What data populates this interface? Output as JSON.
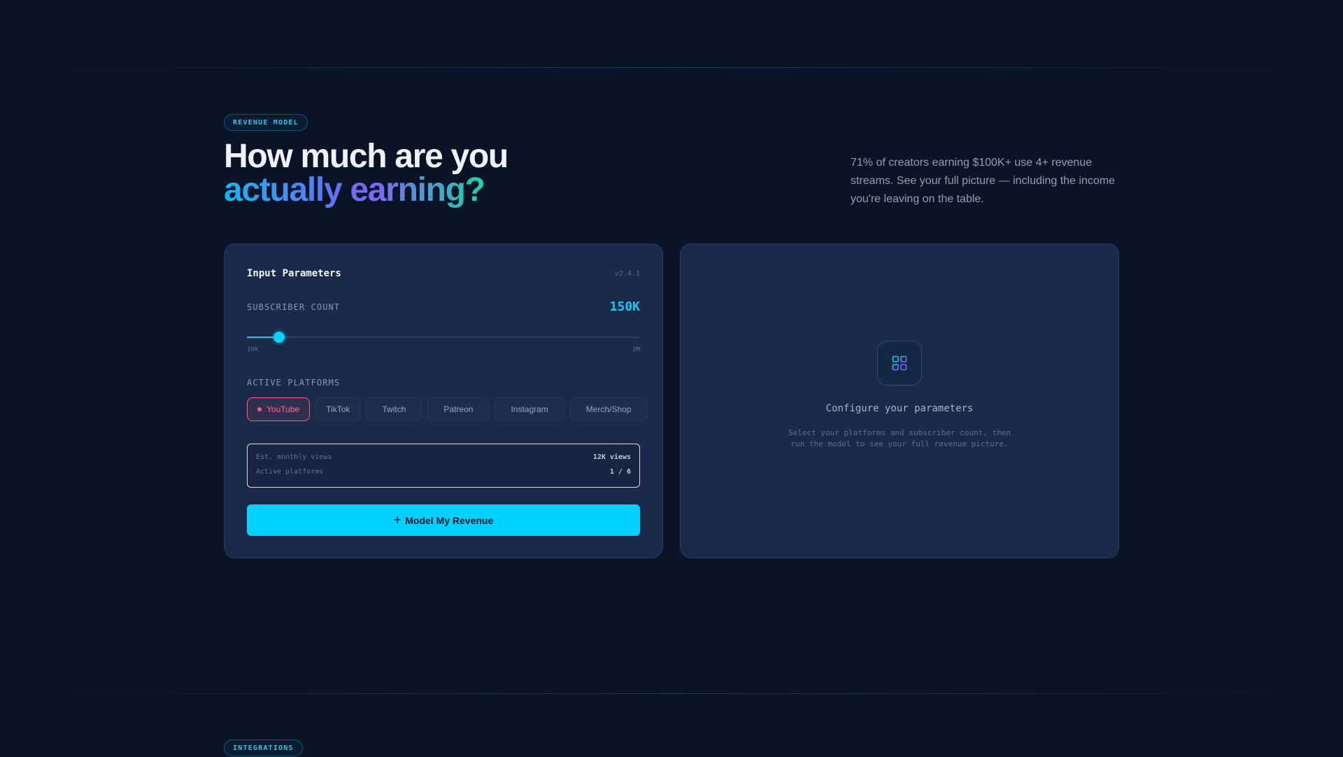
{
  "colors": {
    "background": "#0a1426",
    "card": "#1b2a4a",
    "accent": "#00d1ff",
    "active_chip": "#ff5c80",
    "gradient_start": "#18b5f2",
    "gradient_mid": "#6a6cf4",
    "gradient_end": "#1dd3a6"
  },
  "hero": {
    "badge": "REVENUE MODEL",
    "title_line1": "How much are you",
    "title_line2": "actually earning?",
    "description": "71% of creators earning $100K+ use 4+ revenue streams. See your full picture — including the income you're leaving on the table."
  },
  "input_panel": {
    "title": "Input Parameters",
    "version": "v2.4.1",
    "subscriber": {
      "label": "SUBSCRIBER COUNT",
      "value_display": "150K",
      "min_label": "10K",
      "max_label": "2M",
      "slider_fraction": 0.082
    },
    "platforms": {
      "label": "ACTIVE PLATFORMS",
      "items": [
        {
          "label": "YouTube",
          "active": true
        },
        {
          "label": "TikTok",
          "active": false
        },
        {
          "label": "Twitch",
          "active": false
        },
        {
          "label": "Patreon",
          "active": false
        },
        {
          "label": "Instagram",
          "active": false
        },
        {
          "label": "Merch/Shop",
          "active": false
        }
      ]
    },
    "summary": {
      "views_label": "Est. monthly views",
      "views_value": "12K views",
      "platforms_label": "Active platforms",
      "platforms_value": "1 / 6"
    },
    "cta_icon": "plus-icon",
    "cta_label": "Model My Revenue"
  },
  "result_panel": {
    "icon": "grid-icon",
    "title": "Configure your parameters",
    "text": "Select your platforms and subscriber count, then run the model to see your full revenue picture."
  },
  "next_section": {
    "badge": "INTEGRATIONS"
  }
}
